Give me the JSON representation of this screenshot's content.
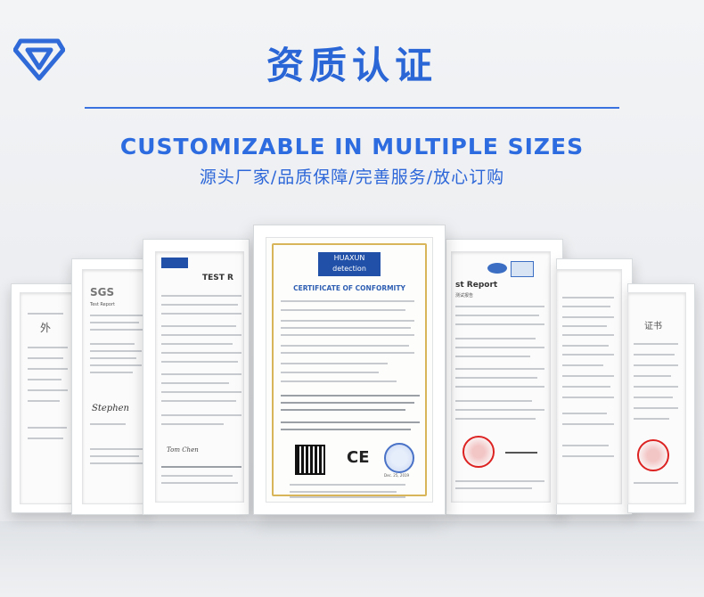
{
  "header": {
    "title_cn": "资质认证",
    "subtitle_en": "CUSTOMIZABLE IN MULTIPLE SIZES",
    "subtitle_cn": "源头厂家/品质保障/完善服务/放心订购"
  },
  "colors": {
    "brand_blue": "#2b66d6",
    "rule_blue": "#3a72e0",
    "gold_border": "#d9b55a",
    "seal_red": "#dd2222"
  },
  "logo": {
    "icon": "diamond-v-logo-icon"
  },
  "certificates": {
    "left_far": {
      "text": "外"
    },
    "left_sgs": {
      "brand": "SGS",
      "heading": "Test Report",
      "signature": "Stephen"
    },
    "left_test": {
      "heading": "TEST R",
      "signature": "Tom Chen"
    },
    "center": {
      "logo_line1": "HUAXUN",
      "logo_line2": "detection",
      "title": "CERTIFICATE OF CONFORMITY",
      "mark": "CE",
      "date": "Dec. 25, 2019"
    },
    "right_test": {
      "heading": "st Report",
      "sub": "测试报告"
    },
    "right_far": {
      "text": "证书"
    }
  }
}
